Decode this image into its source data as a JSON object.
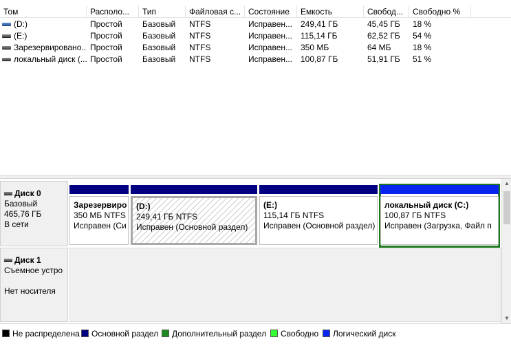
{
  "volume_list": {
    "columns": [
      "Том",
      "Располо...",
      "Тип",
      "Файловая с...",
      "Состояние",
      "Емкость",
      "Свобод...",
      "Свободно %"
    ],
    "rows": [
      {
        "icon": "blue",
        "name": "(D:)",
        "layout": "Простой",
        "type": "Базовый",
        "fs": "NTFS",
        "status": "Исправен...",
        "capacity": "249,41 ГБ",
        "free": "45,45 ГБ",
        "free_pct": "18 %"
      },
      {
        "icon": "gray",
        "name": "(E:)",
        "layout": "Простой",
        "type": "Базовый",
        "fs": "NTFS",
        "status": "Исправен...",
        "capacity": "115,14 ГБ",
        "free": "62,52 ГБ",
        "free_pct": "54 %"
      },
      {
        "icon": "gray",
        "name": "Зарезервировано...",
        "layout": "Простой",
        "type": "Базовый",
        "fs": "NTFS",
        "status": "Исправен...",
        "capacity": "350 МБ",
        "free": "64 МБ",
        "free_pct": "18 %"
      },
      {
        "icon": "gray",
        "name": "локальный диск (...",
        "layout": "Простой",
        "type": "Базовый",
        "fs": "NTFS",
        "status": "Исправен...",
        "capacity": "100,87 ГБ",
        "free": "51,91 ГБ",
        "free_pct": "51 %"
      }
    ]
  },
  "disks": [
    {
      "title": "Диск 0",
      "type": "Базовый",
      "size": "465,76 ГБ",
      "state": "В сети",
      "partitions": [
        {
          "name": "Зарезервиро",
          "size_fs": "350 МБ NTFS",
          "status": "Исправен (Си"
        },
        {
          "name": "(D:)",
          "size_fs": "249,41 ГБ NTFS",
          "status": "Исправен (Основной раздел)"
        },
        {
          "name": "(E:)",
          "size_fs": "115,14 ГБ NTFS",
          "status": "Исправен (Основной раздел)"
        },
        {
          "name": "локальный диск  (C:)",
          "size_fs": "100,87 ГБ NTFS",
          "status": "Исправен (Загрузка, Файл п"
        }
      ]
    },
    {
      "title": "Диск 1",
      "type": "Съемное устро",
      "status": "Нет носителя"
    }
  ],
  "legend": [
    {
      "label": "Не распределена",
      "color": "#000000"
    },
    {
      "label": "Основной раздел",
      "color": "#000080"
    },
    {
      "label": "Дополнительный раздел",
      "color": "#1f8a1f"
    },
    {
      "label": "Свободно",
      "color": "#33ff33"
    },
    {
      "label": "Логический диск",
      "color": "#0a24f0"
    }
  ],
  "colors": {
    "primary_partition_bar": "#000080",
    "logical_disk_bar": "#0a24f0",
    "selection_outline": "#1f7a1f"
  }
}
